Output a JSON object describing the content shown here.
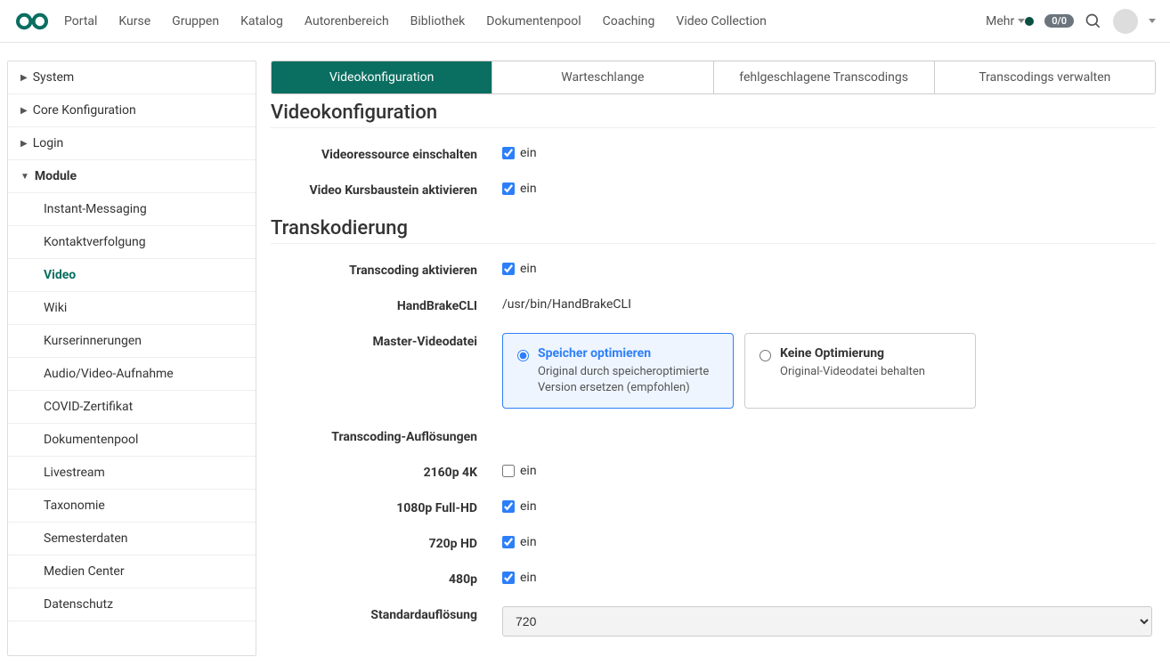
{
  "topnav": {
    "items": [
      "Portal",
      "Kurse",
      "Gruppen",
      "Katalog",
      "Autorenbereich",
      "Bibliothek",
      "Dokumentenpool",
      "Coaching",
      "Video Collection"
    ],
    "more": "Mehr",
    "badge": "0/0"
  },
  "sidebar": {
    "groups": [
      "System",
      "Core Konfiguration",
      "Login",
      "Module"
    ],
    "module_items": [
      "Instant-Messaging",
      "Kontaktverfolgung",
      "Video",
      "Wiki",
      "Kurserinnerungen",
      "Audio/Video-Aufnahme",
      "COVID-Zertifikat",
      "Dokumentenpool",
      "Livestream",
      "Taxonomie",
      "Semesterdaten",
      "Medien Center",
      "Datenschutz"
    ],
    "active": "Video"
  },
  "tabs": [
    "Videokonfiguration",
    "Warteschlange",
    "fehlgeschlagene Transcodings",
    "Transcodings verwalten"
  ],
  "h_video": "Videokonfiguration",
  "h_trans": "Transkodierung",
  "labels": {
    "videores": "Videoressource einschalten",
    "videokurs": "Video Kursbaustein aktivieren",
    "trans_on": "Transcoding aktivieren",
    "handbrake": "HandBrakeCLI",
    "master": "Master-Videodatei",
    "resolutions": "Transcoding-Auflösungen",
    "r2160": "2160p 4K",
    "r1080": "1080p Full-HD",
    "r720": "720p HD",
    "r480": "480p",
    "default": "Standardauflösung"
  },
  "values": {
    "on": "ein",
    "handbrake_path": "/usr/bin/HandBrakeCLI",
    "default_res": "720"
  },
  "master_options": {
    "opt1_title": "Speicher optimieren",
    "opt1_desc": "Original durch speicheroptimierte Version ersetzen (empfohlen)",
    "opt2_title": "Keine Optimierung",
    "opt2_desc": "Original-Videodatei behalten"
  }
}
